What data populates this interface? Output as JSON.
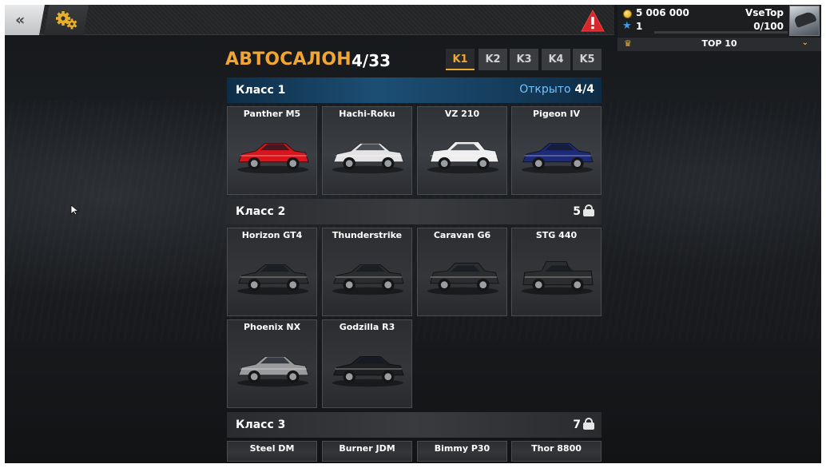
{
  "topbar": {
    "back_icon": "double-chevron-left-icon",
    "settings_icon": "gears-icon",
    "alert_icon": "warning-triangle-icon"
  },
  "player": {
    "money": "5 006 000",
    "level": "1",
    "name": "VseTop",
    "xp": "0/100",
    "xp_progress": 0,
    "rank": "TOP 10"
  },
  "dealership": {
    "title": "АВТОСАЛОН",
    "count": "4/33"
  },
  "tabs": [
    {
      "label": "K1",
      "active": true
    },
    {
      "label": "K2",
      "active": false
    },
    {
      "label": "K3",
      "active": false
    },
    {
      "label": "K4",
      "active": false
    },
    {
      "label": "K5",
      "active": false
    }
  ],
  "classes": [
    {
      "name": "Класс 1",
      "status_label": "Открыто",
      "status_value": "4/4",
      "locked": false,
      "cars": [
        {
          "name": "Panther M5",
          "color": "#d8141c"
        },
        {
          "name": "Hachi-Roku",
          "color": "#e4e4e6"
        },
        {
          "name": "VZ 210",
          "color": "#efefef"
        },
        {
          "name": "Pigeon IV",
          "color": "#1c2a78"
        }
      ]
    },
    {
      "name": "Класс 2",
      "status_value": "5",
      "locked": true,
      "cars": [
        {
          "name": "Horizon GT4",
          "color": "#2c2d2f"
        },
        {
          "name": "Thunderstrike",
          "color": "#2c2d2f"
        },
        {
          "name": "Caravan G6",
          "color": "#2c2d2f"
        },
        {
          "name": "STG 440",
          "color": "#2c2d2f"
        },
        {
          "name": "Phoenix NX",
          "color": "#9a9b9d"
        },
        {
          "name": "Godzilla R3",
          "color": "#1e1f21"
        }
      ]
    },
    {
      "name": "Класс 3",
      "status_value": "7",
      "locked": true,
      "cars": [
        {
          "name": "Steel DM"
        },
        {
          "name": "Burner JDM"
        },
        {
          "name": "Bimmy P30"
        },
        {
          "name": "Thor 8800"
        }
      ]
    }
  ]
}
